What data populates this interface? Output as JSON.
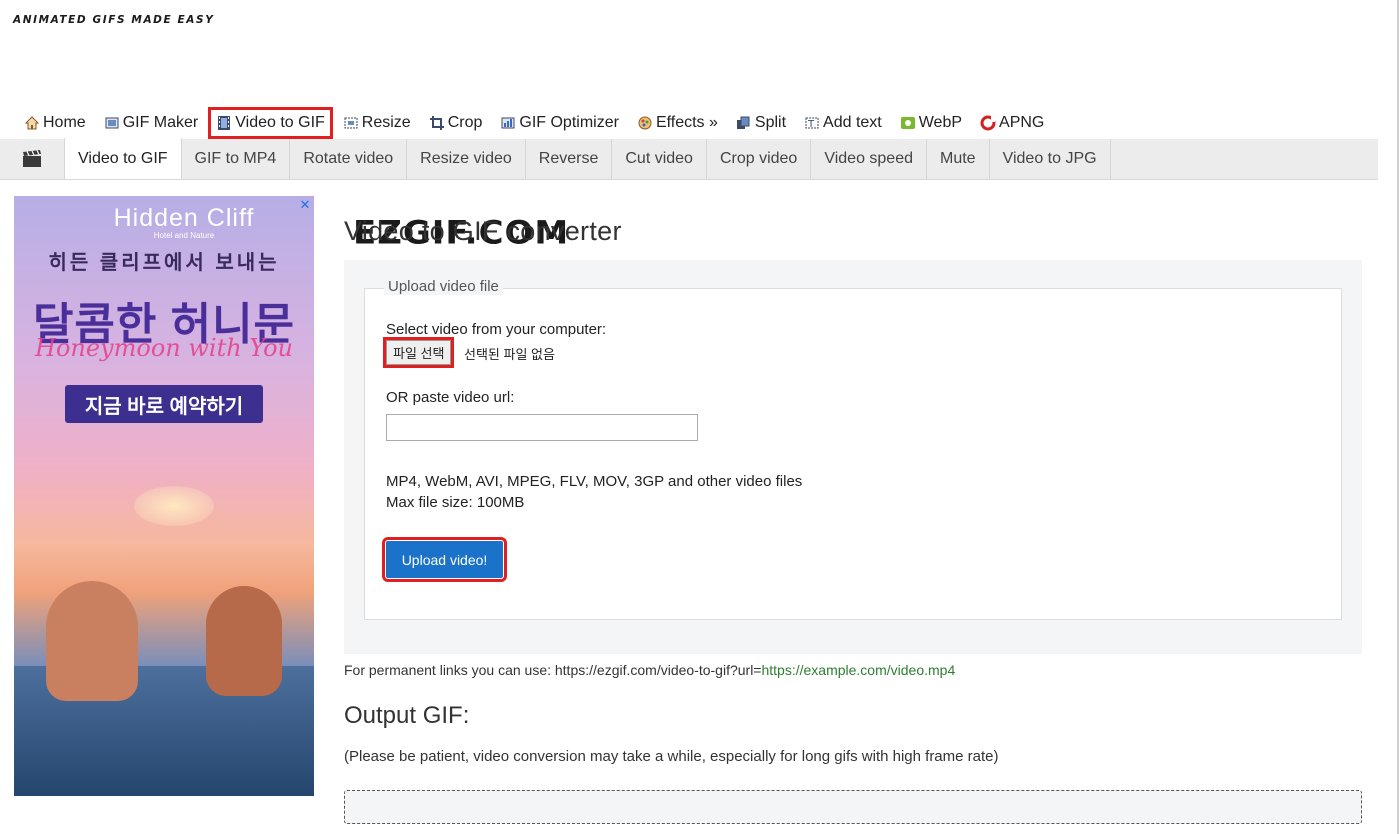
{
  "logo": {
    "main": "EZGIF.COM",
    "tagline": "ANIMATED GIFS MADE EASY"
  },
  "topnav": [
    {
      "label": "Home",
      "icon": "home-icon"
    },
    {
      "label": "GIF Maker",
      "icon": "gif-maker-icon"
    },
    {
      "label": "Video to GIF",
      "icon": "film-icon",
      "active": true
    },
    {
      "label": "Resize",
      "icon": "resize-icon"
    },
    {
      "label": "Crop",
      "icon": "crop-icon"
    },
    {
      "label": "GIF Optimizer",
      "icon": "optimizer-icon"
    },
    {
      "label": "Effects »",
      "icon": "effects-icon"
    },
    {
      "label": "Split",
      "icon": "split-icon"
    },
    {
      "label": "Add text",
      "icon": "add-text-icon"
    },
    {
      "label": "WebP",
      "icon": "webp-icon"
    },
    {
      "label": "APNG",
      "icon": "apng-icon"
    }
  ],
  "subnav": {
    "icon": "clapperboard-icon",
    "tabs": [
      "Video to GIF",
      "GIF to MP4",
      "Rotate video",
      "Resize video",
      "Reverse",
      "Cut video",
      "Crop video",
      "Video speed",
      "Mute",
      "Video to JPG"
    ]
  },
  "ad": {
    "brand": "Hidden Cliff",
    "brand_sub": "Hotel and Nature",
    "line1": "히든 클리프에서 보내는",
    "line2": "달콤한 허니문",
    "line3": "Honeymoon with You",
    "cta": "지금 바로 예약하기",
    "close": "✕"
  },
  "main": {
    "title": "Video to GIF converter",
    "legend": "Upload video file",
    "select_label": "Select video from your computer:",
    "file_button": "파일 선택",
    "no_file": "선택된 파일 없음",
    "url_label": "OR paste video url:",
    "url_value": "",
    "formats": "MP4, WebM, AVI, MPEG, FLV, MOV, 3GP and other video files",
    "max_size": "Max file size: 100MB",
    "upload_button": "Upload video!",
    "permalink_prefix": "For permanent links you can use: https://ezgif.com/video-to-gif?url=",
    "permalink_url": "https://example.com/video.mp4",
    "output_title": "Output GIF:",
    "patience": "(Please be patient, video conversion may take a while, especially for long gifs with high frame rate)"
  },
  "colors": {
    "accent_red": "#e02020",
    "upload_blue": "#1a73c8",
    "link_green": "#2e7d32"
  }
}
